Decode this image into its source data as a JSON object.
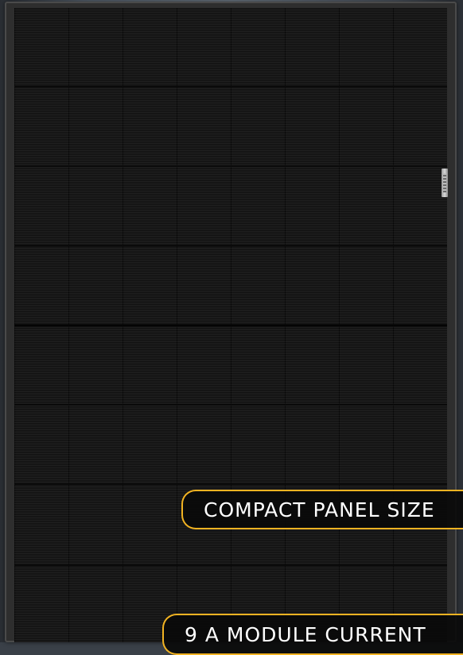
{
  "badges": [
    {
      "label": "COMPACT PANEL SIZE"
    },
    {
      "label": "9 A MODULE CURRENT"
    }
  ],
  "colors": {
    "accent": "#f2b322",
    "panel": "#151515",
    "frame": "#2e2e2e",
    "badge_text": "#ffffff"
  }
}
